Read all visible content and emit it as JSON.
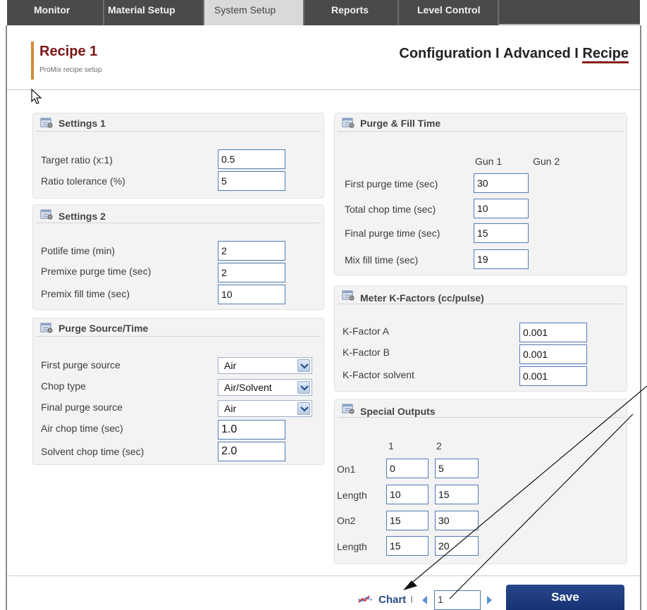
{
  "tabs": [
    {
      "label": "Monitor",
      "active": false
    },
    {
      "label": "Material Setup",
      "active": false
    },
    {
      "label": "System Setup",
      "active": true
    },
    {
      "label": "Reports",
      "active": false
    },
    {
      "label": "Level Control",
      "active": false
    }
  ],
  "header": {
    "title": "Recipe 1",
    "subtitle": "ProMix recipe setup",
    "crumbs": [
      "Configuration",
      "Advanced",
      "Recipe"
    ],
    "crumb_separator": " I ",
    "active_crumb": "Recipe"
  },
  "settings1": {
    "title": "Settings 1",
    "rows": [
      {
        "label": "Target ratio (x:1)",
        "value": "0.5"
      },
      {
        "label": "Ratio tolerance (%)",
        "value": "5"
      }
    ]
  },
  "settings2": {
    "title": "Settings 2",
    "rows": [
      {
        "label": "Potlife time (min)",
        "value": "2"
      },
      {
        "label": "Premixe purge time (sec)",
        "value": "2"
      },
      {
        "label": "Premix fill time (sec)",
        "value": "10"
      }
    ]
  },
  "purge_source": {
    "title": "Purge Source/Time",
    "rows": [
      {
        "label": "First purge source",
        "value": "Air",
        "kind": "select"
      },
      {
        "label": "Chop type",
        "value": "Air/Solvent",
        "kind": "select"
      },
      {
        "label": "Final purge source",
        "value": "Air",
        "kind": "select"
      },
      {
        "label": "Air chop time (sec)",
        "value": "1.0",
        "kind": "input"
      },
      {
        "label": "Solvent chop time (sec)",
        "value": "2.0",
        "kind": "input"
      }
    ]
  },
  "purge_fill": {
    "title": "Purge & Fill Time",
    "col_headers": [
      "Gun 1",
      "Gun 2"
    ],
    "rows": [
      {
        "label": "First purge time (sec)",
        "value": "30"
      },
      {
        "label": "Total chop time (sec)",
        "value": "10"
      },
      {
        "label": "Final purge time (sec)",
        "value": "15"
      },
      {
        "label": "Mix fill time (sec)",
        "value": "19"
      }
    ]
  },
  "kfactors": {
    "title": "Meter K-Factors (cc/pulse)",
    "rows": [
      {
        "label": "K-Factor A",
        "value": "0.001"
      },
      {
        "label": "K-Factor B",
        "value": "0.001"
      },
      {
        "label": "K-Factor solvent",
        "value": "0.001"
      }
    ]
  },
  "special_outputs": {
    "title": "Special Outputs",
    "col_headers": [
      "1",
      "2"
    ],
    "rows": [
      {
        "label": "On1",
        "values": [
          "0",
          "5"
        ]
      },
      {
        "label": "Length",
        "values": [
          "10",
          "15"
        ]
      },
      {
        "label": "On2",
        "values": [
          "15",
          "30"
        ]
      },
      {
        "label": "Length",
        "values": [
          "15",
          "20"
        ]
      }
    ]
  },
  "footer": {
    "chart_label": "Chart",
    "separator": "I",
    "page": "1",
    "save_label": "Save"
  },
  "colors": {
    "accent_title": "#7a1515",
    "title_bar": "#d08a3a",
    "nav_dark": "#4a4a4a",
    "save_button": "#1f3d80"
  },
  "icons": [
    "settings-panel-icon",
    "chart-icon",
    "prev-page-icon",
    "next-page-icon",
    "chevron-down-icon",
    "mouse-pointer-icon"
  ]
}
